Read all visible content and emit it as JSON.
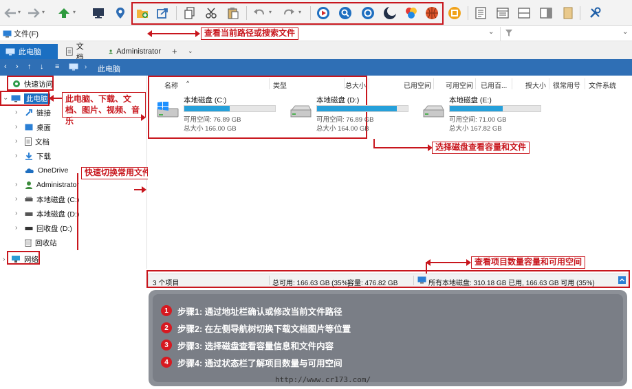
{
  "toolbar": {
    "icons": [
      "back-arrow-icon",
      "forward-arrow-icon",
      "up-folder-icon",
      "monitor-icon",
      "location-pin-icon",
      "new-folder-icon",
      "share-icon",
      "copy-icon",
      "cut-icon",
      "paste-icon",
      "undo-icon",
      "redo-icon",
      "play-icon",
      "search-icon",
      "refresh-search-icon",
      "moon-icon",
      "color-palette-icon",
      "basketball-icon",
      "frame-icon",
      "document-icon",
      "details-pane-icon",
      "split-view-icon",
      "preview-pane-icon",
      "bookmark-icon",
      "tools-icon"
    ]
  },
  "address": {
    "file_menu": "文件(F)",
    "path": "",
    "filter_placeholder": ""
  },
  "tabs": [
    {
      "label": "此电脑"
    },
    {
      "label": "文档"
    },
    {
      "label": "Administrator"
    }
  ],
  "tab_add": "+",
  "tab_more": "⌄",
  "nav": {
    "back": "‹",
    "forward": "›",
    "up": "↑",
    "down": "↓",
    "menu": "≡",
    "crumb": "此电脑",
    "sep": "›"
  },
  "sidebar": {
    "items": [
      {
        "label": "快速访问"
      },
      {
        "label": "此电脑"
      },
      {
        "label": "链接"
      },
      {
        "label": "桌面"
      },
      {
        "label": "文档"
      },
      {
        "label": "下载"
      },
      {
        "label": "OneDrive"
      },
      {
        "label": "Administrator"
      },
      {
        "label": "本地磁盘 (C:)"
      },
      {
        "label": "本地磁盘 (D:)"
      },
      {
        "label": "回收盘 (D:)"
      },
      {
        "label": "回收站"
      },
      {
        "label": "网络"
      }
    ]
  },
  "columns": [
    "名称",
    "类型",
    "总大小",
    "已用空间",
    "可用空间",
    "已用百...",
    "授大小",
    "很常用号",
    "文件系统"
  ],
  "drives": [
    {
      "name": "本地磁盘 (C:)",
      "free": "可用空间: 76.89 GB",
      "total": "总大小 166.00 GB",
      "used_fraction": 0.5
    },
    {
      "name": "本地磁盘 (D:)",
      "free": "可用空间: 76.89 GB",
      "total": "总大小 164.00 GB",
      "used_fraction": 0.88
    },
    {
      "name": "本地磁盘 (E:)",
      "free": "可用空间: 71.00 GB",
      "total": "总大小 167.82 GB",
      "used_fraction": 0.58
    }
  ],
  "status": {
    "count": "3 个项目",
    "free": "总可用: 166.63 GB (35%)",
    "capacity": "容量: 476.82 GB",
    "all_drives": "所有本地磁盘: 310.18 GB 已用, 166.63 GB 可用 (35%)"
  },
  "annotations": {
    "address": "查看当前路径或搜索文件",
    "sidebar": "此电脑、下载、文档、图片、视频、音乐",
    "quick": "快速切换常用文件夹位置",
    "drives": "选择磁盘查看容量和文件",
    "status": "查看项目数量容量和可用空间"
  },
  "steps": [
    {
      "num": "1",
      "text": "步骤1: 通过地址栏确认或修改当前文件路径"
    },
    {
      "num": "2",
      "text": "步骤2: 在左侧导航树切换下载文档图片等位置"
    },
    {
      "num": "3",
      "text": "步骤3: 选择磁盘查看容量信息和文件内容"
    },
    {
      "num": "4",
      "text": "步骤4: 通过状态栏了解项目数量与可用空间"
    }
  ],
  "watermark": "http://www.cr173.com/",
  "colors": {
    "accent": "#1b6fc2",
    "nav": "#2f6fb5",
    "annotation": "#c8161d",
    "drive_fill": "#26a0da",
    "step_badge": "#d71920"
  }
}
